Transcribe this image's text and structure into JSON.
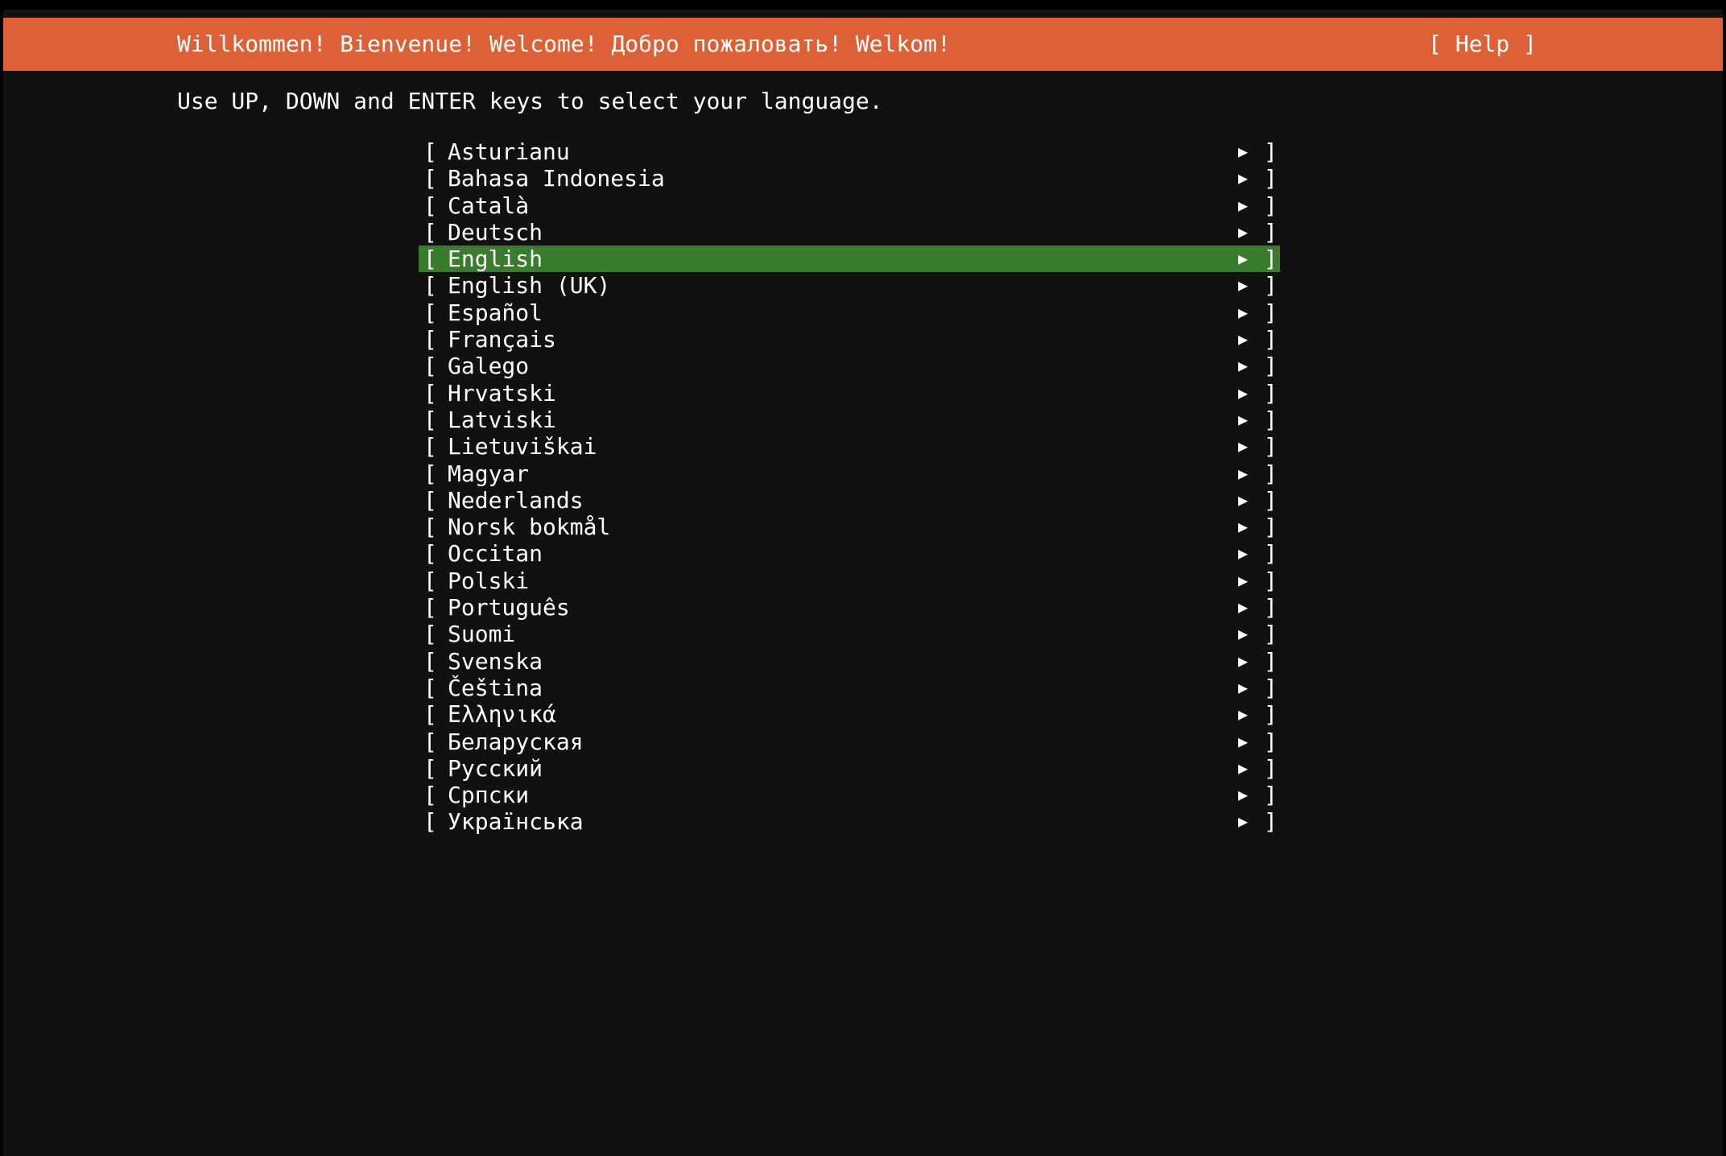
{
  "header": {
    "title": "Willkommen! Bienvenue! Welcome! Добро пожаловать! Welkom!",
    "help_label": "[ Help ]"
  },
  "instruction": "Use UP, DOWN and ENTER keys to select your language.",
  "languages": {
    "bracket_open": "[",
    "bracket_close": "]",
    "arrow_glyph": "▶",
    "selected": "English",
    "items": [
      {
        "label": "Asturianu"
      },
      {
        "label": "Bahasa Indonesia"
      },
      {
        "label": "Català"
      },
      {
        "label": "Deutsch"
      },
      {
        "label": "English"
      },
      {
        "label": "English (UK)"
      },
      {
        "label": "Español"
      },
      {
        "label": "Français"
      },
      {
        "label": "Galego"
      },
      {
        "label": "Hrvatski"
      },
      {
        "label": "Latviski"
      },
      {
        "label": "Lietuviškai"
      },
      {
        "label": "Magyar"
      },
      {
        "label": "Nederlands"
      },
      {
        "label": "Norsk bokmål"
      },
      {
        "label": "Occitan"
      },
      {
        "label": "Polski"
      },
      {
        "label": "Português"
      },
      {
        "label": "Suomi"
      },
      {
        "label": "Svenska"
      },
      {
        "label": "Čeština"
      },
      {
        "label": "Ελληνικά"
      },
      {
        "label": "Беларуская"
      },
      {
        "label": "Русский"
      },
      {
        "label": "Српски"
      },
      {
        "label": "Українська"
      }
    ]
  },
  "colors": {
    "header_bg": "#dd6036",
    "selected_bg": "#3a7c2d",
    "screen_bg": "#111111",
    "text": "#ffffff"
  }
}
